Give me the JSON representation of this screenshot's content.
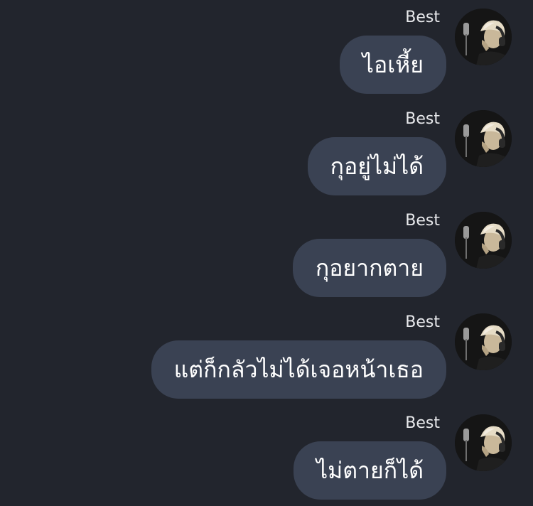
{
  "messages": [
    {
      "sender": "Best",
      "text": "ไอเหี้ย",
      "avatar_icon": "user-avatar-headphones-icon"
    },
    {
      "sender": "Best",
      "text": "กุอยู่ไม่ได้",
      "avatar_icon": "user-avatar-headphones-icon"
    },
    {
      "sender": "Best",
      "text": "กุอยากตาย",
      "avatar_icon": "user-avatar-headphones-icon"
    },
    {
      "sender": "Best",
      "text": "แต่ก็กลัวไม่ได้เจอหน้าเธอ",
      "avatar_icon": "user-avatar-headphones-icon"
    },
    {
      "sender": "Best",
      "text": "ไม่ตายก็ได้",
      "avatar_icon": "user-avatar-headphones-icon"
    }
  ],
  "colors": {
    "background": "#22252d",
    "bubble": "#3a4253",
    "text": "#ffffff",
    "sender": "#e8e9ec"
  }
}
